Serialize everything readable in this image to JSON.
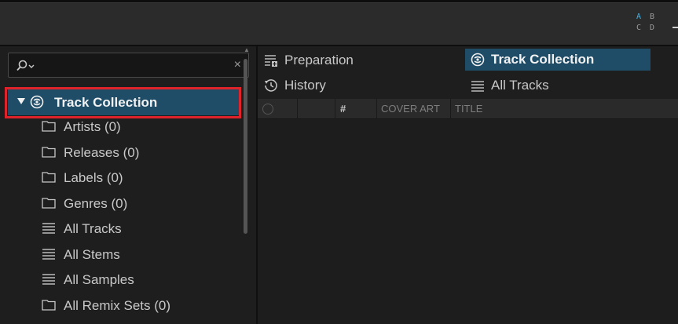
{
  "decks": [
    "A",
    "B",
    "C",
    "D"
  ],
  "active_deck": "A",
  "search": {
    "value": "",
    "placeholder": "",
    "clear_glyph": "×"
  },
  "tree": {
    "root": {
      "label": "Track Collection",
      "icon": "track-collection-icon",
      "expanded": true
    },
    "items": [
      {
        "label": "Artists (0)",
        "icon": "folder-icon"
      },
      {
        "label": "Releases (0)",
        "icon": "folder-icon"
      },
      {
        "label": "Labels (0)",
        "icon": "folder-icon"
      },
      {
        "label": "Genres (0)",
        "icon": "folder-icon"
      },
      {
        "label": "All Tracks",
        "icon": "list-icon"
      },
      {
        "label": "All Stems",
        "icon": "list-icon"
      },
      {
        "label": "All Samples",
        "icon": "list-icon"
      },
      {
        "label": "All Remix Sets (0)",
        "icon": "folder-icon"
      }
    ]
  },
  "favorites": [
    {
      "label": "Preparation",
      "icon": "preparation-list-icon",
      "selected": false
    },
    {
      "label": "Track Collection",
      "icon": "track-collection-icon",
      "selected": true
    },
    {
      "label": "History",
      "icon": "history-icon",
      "selected": false
    },
    {
      "label": "All Tracks",
      "icon": "list-icon",
      "selected": false
    }
  ],
  "table": {
    "columns": [
      "",
      "",
      "#",
      "COVER ART",
      "TITLE"
    ]
  },
  "colors": {
    "selection": "#1f4c67",
    "highlight_box": "#e0232b",
    "active_deck": "#46b3e6"
  }
}
